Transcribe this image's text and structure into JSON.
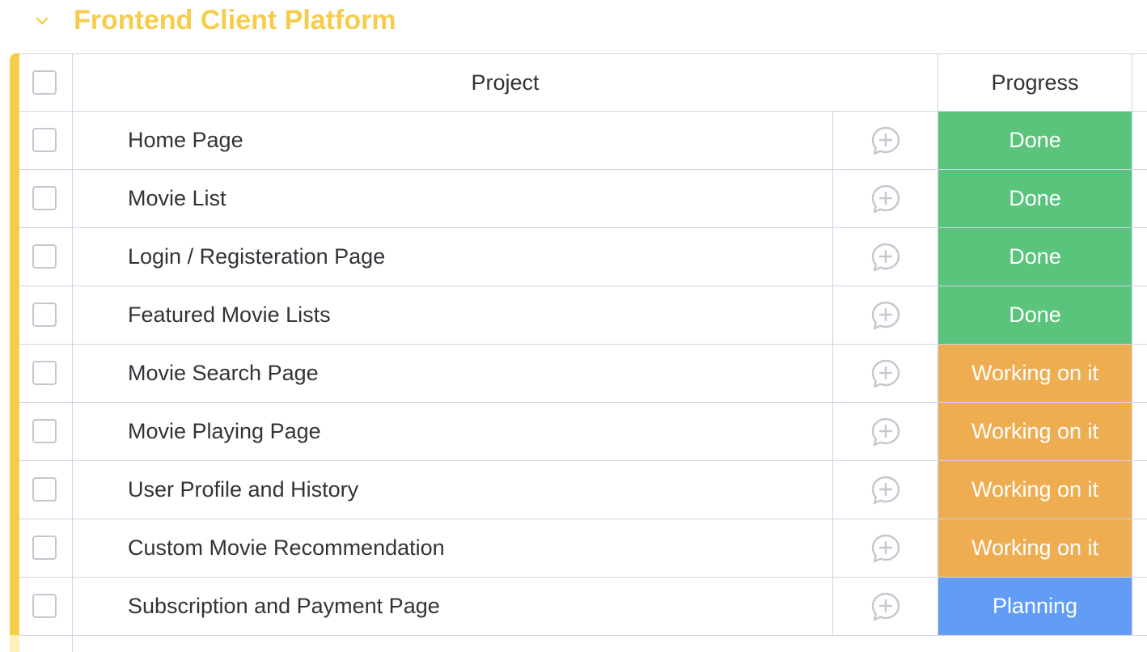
{
  "group": {
    "title": "Frontend Client Platform",
    "color": "#f6cd4a",
    "chevron_icon": "chevron-down-icon"
  },
  "columns": {
    "project": "Project",
    "progress": "Progress"
  },
  "status_colors": {
    "Done": "#5ac47d",
    "Working on it": "#efad52",
    "Planning": "#629cf4"
  },
  "rows": [
    {
      "name": "Home Page",
      "status": "Done"
    },
    {
      "name": "Movie List",
      "status": "Done"
    },
    {
      "name": "Login / Registeration Page",
      "status": "Done"
    },
    {
      "name": "Featured Movie Lists",
      "status": "Done"
    },
    {
      "name": "Movie Search Page",
      "status": "Working on it"
    },
    {
      "name": "Movie Playing Page",
      "status": "Working on it"
    },
    {
      "name": "User Profile and History",
      "status": "Working on it"
    },
    {
      "name": "Custom Movie Recommendation",
      "status": "Working on it"
    },
    {
      "name": "Subscription and Payment Page",
      "status": "Planning"
    }
  ],
  "update_icon": "add-update-icon"
}
